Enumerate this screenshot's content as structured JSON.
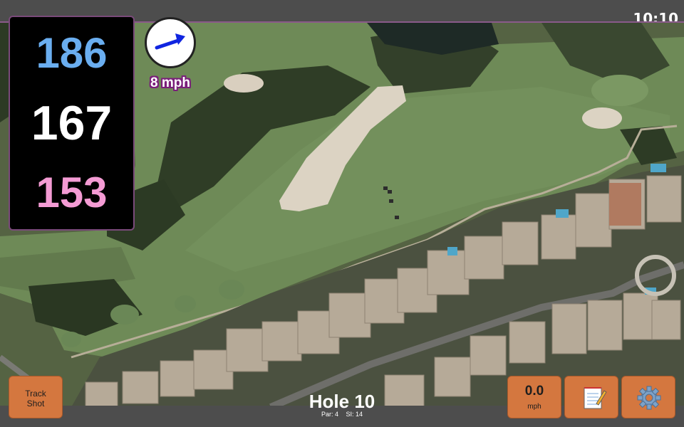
{
  "status": {
    "time": "10:10"
  },
  "distances": {
    "back": "186",
    "middle": "167",
    "front": "153"
  },
  "wind": {
    "speed_label": "8 mph",
    "icon": "wind-direction-arrow-icon"
  },
  "hole": {
    "title": "Hole 10",
    "par": "Par: 4",
    "stroke_index": "SI: 14"
  },
  "buttons": {
    "track_shot_line1": "Track",
    "track_shot_line2": "Shot",
    "wind_value": "0.0",
    "wind_unit": "mph",
    "notes_icon": "notepad-icon",
    "settings_icon": "gear-icon"
  },
  "colors": {
    "back_distance": "#6aaef0",
    "middle_distance": "#ffffff",
    "front_distance": "#f49bd4",
    "button": "#d4773f",
    "accent": "#7a1f7a"
  }
}
